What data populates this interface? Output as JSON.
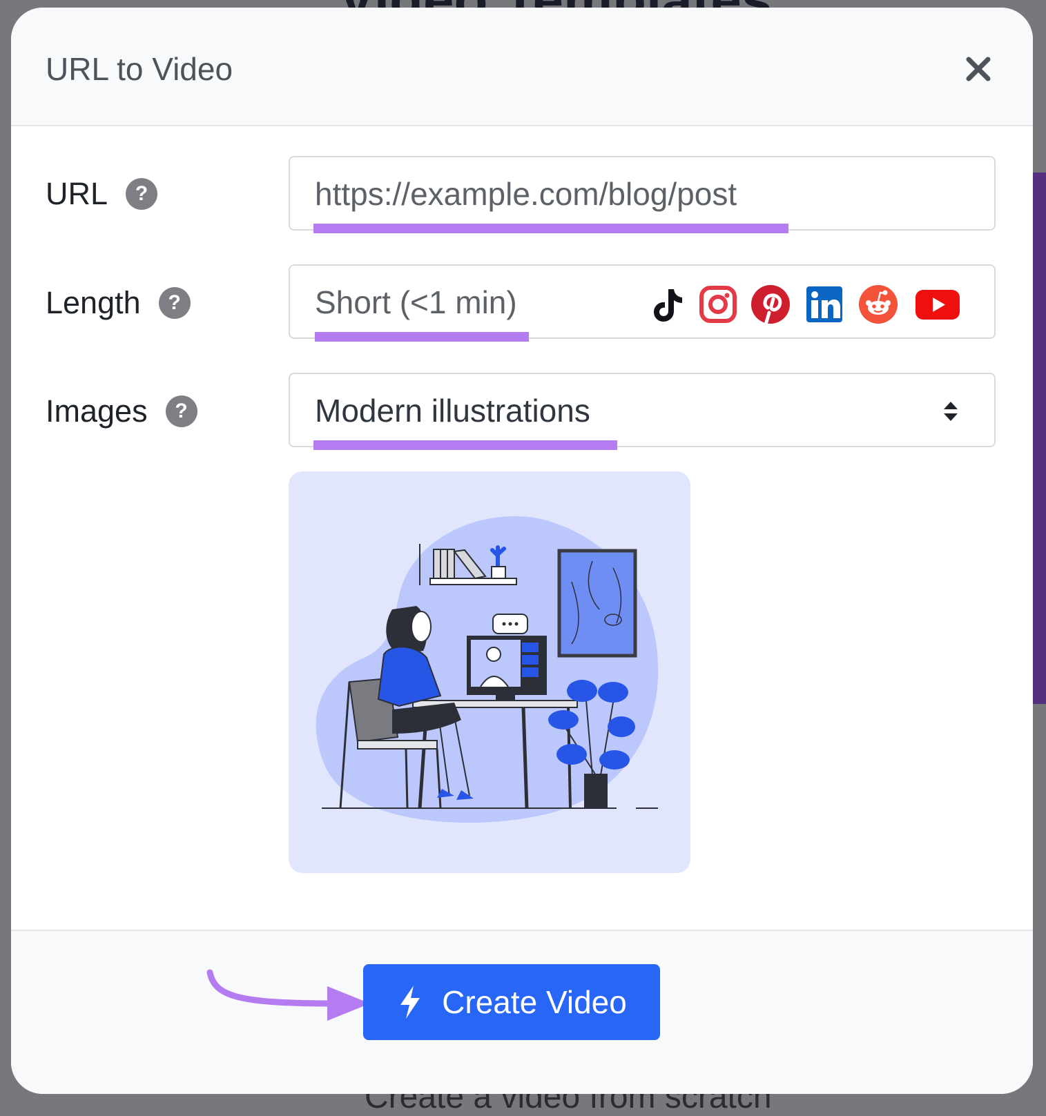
{
  "background": {
    "heading": "Video Templates",
    "footer_text": "Create a video from scratch"
  },
  "modal": {
    "title": "URL to Video",
    "close_icon": "close-icon"
  },
  "form": {
    "url": {
      "label": "URL",
      "value": "https://example.com/blog/post",
      "help": "?"
    },
    "length": {
      "label": "Length",
      "value": "Short (<1 min)",
      "help": "?",
      "platforms": [
        "tiktok-icon",
        "instagram-icon",
        "pinterest-icon",
        "linkedin-icon",
        "reddit-icon",
        "youtube-icon"
      ]
    },
    "images": {
      "label": "Images",
      "value": "Modern illustrations",
      "help": "?"
    }
  },
  "actions": {
    "create_label": "Create Video"
  },
  "colors": {
    "accent": "#2866f6",
    "highlight": "#b57bf1",
    "illustration_bg": "#e1e6fc"
  }
}
